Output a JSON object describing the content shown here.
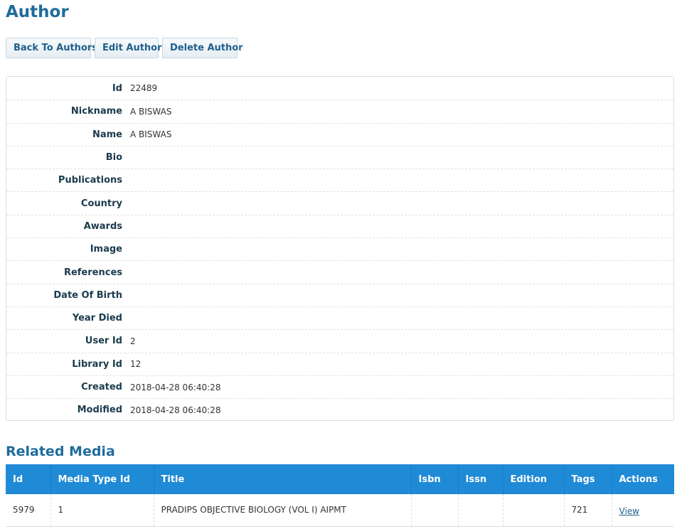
{
  "page": {
    "title": "Author"
  },
  "actions": {
    "back": "Back To Authors",
    "edit": "Edit Author",
    "delete": "Delete Author"
  },
  "fields": [
    {
      "label": "Id",
      "value": "22489"
    },
    {
      "label": "Nickname",
      "value": "A BISWAS"
    },
    {
      "label": "Name",
      "value": "A BISWAS"
    },
    {
      "label": "Bio",
      "value": ""
    },
    {
      "label": "Publications",
      "value": ""
    },
    {
      "label": "Country",
      "value": ""
    },
    {
      "label": "Awards",
      "value": ""
    },
    {
      "label": "Image",
      "value": ""
    },
    {
      "label": "References",
      "value": ""
    },
    {
      "label": "Date Of Birth",
      "value": ""
    },
    {
      "label": "Year Died",
      "value": ""
    },
    {
      "label": "User Id",
      "value": "2"
    },
    {
      "label": "Library Id",
      "value": "12"
    },
    {
      "label": "Created",
      "value": "2018-04-28 06:40:28"
    },
    {
      "label": "Modified",
      "value": "2018-04-28 06:40:28"
    }
  ],
  "related": {
    "title": "Related Media",
    "columns": [
      "Id",
      "Media Type Id",
      "Title",
      "Isbn",
      "Issn",
      "Edition",
      "Tags",
      "Actions"
    ],
    "rows": [
      {
        "id": "5979",
        "media_type_id": "1",
        "title": "PRADIPS OBJECTIVE BIOLOGY (VOL I) AIPMT",
        "isbn": "",
        "issn": "",
        "edition": "",
        "tags": "721",
        "action": "View"
      }
    ]
  }
}
